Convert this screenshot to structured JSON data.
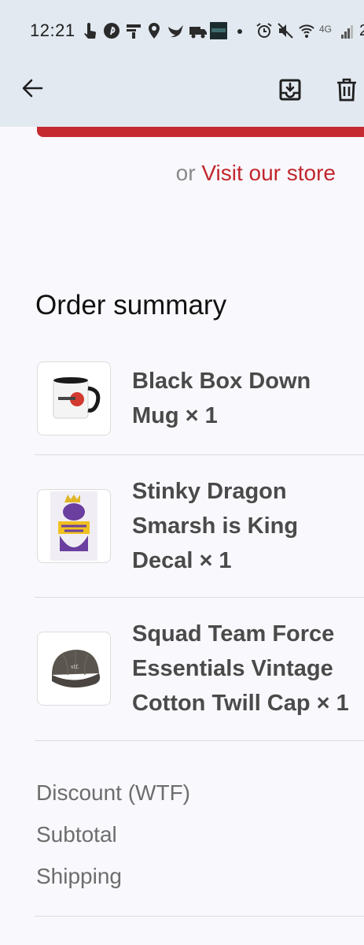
{
  "status_bar": {
    "time": "12:21",
    "network_label": "4G",
    "battery_peek": "2",
    "notification_icons": [
      "touch-icon",
      "pinterest-icon",
      "news-icon",
      "location-icon",
      "bird-icon",
      "truck-icon",
      "media-thumbnail-icon",
      "dot-icon"
    ],
    "system_icons": [
      "alarm-icon",
      "mute-icon",
      "wifi-icon",
      "signal-icon"
    ]
  },
  "app_bar": {
    "back_icon": "arrow-back-icon",
    "archive_icon": "archive-icon",
    "delete_icon": "trash-icon"
  },
  "store": {
    "prefix": "or",
    "link_label": "Visit our store"
  },
  "order_summary": {
    "heading": "Order summary",
    "items": [
      {
        "title": "Black Box Down Mug × 1",
        "image": "mug-image"
      },
      {
        "title": "Stinky Dragon Smarsh is King Decal × 1",
        "image": "decal-image"
      },
      {
        "title": "Squad Team Force Essentials Vintage Cotton Twill Cap × 1",
        "image": "cap-image"
      }
    ],
    "totals": [
      {
        "label": "Discount (WTF)"
      },
      {
        "label": "Subtotal"
      },
      {
        "label": "Shipping"
      }
    ]
  },
  "colors": {
    "header_bg": "#e2e9f0",
    "page_bg": "#f9f9fd",
    "accent_red": "#c62a31",
    "link_red": "#c1272d"
  }
}
